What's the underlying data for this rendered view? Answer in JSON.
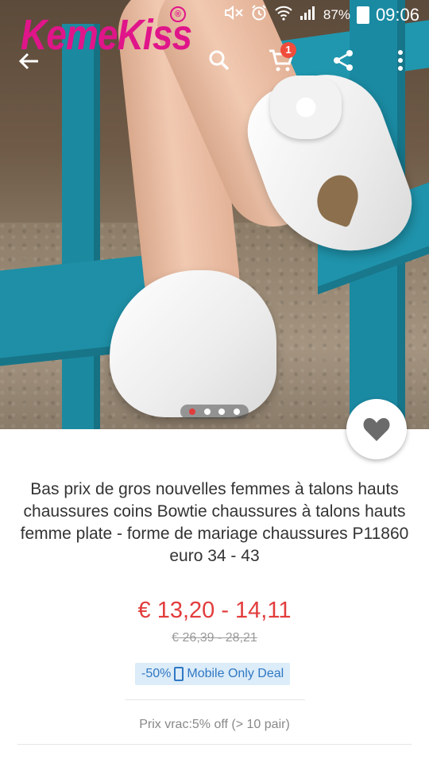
{
  "status_bar": {
    "battery_percent": "87%",
    "time": "09:06",
    "icons": [
      "mute-icon",
      "alarm-icon",
      "wifi-icon",
      "signal-icon",
      "battery-icon"
    ]
  },
  "app": {
    "logo_text": "KemeKiss",
    "logo_mark": "®",
    "brand_color": "#e0158a",
    "cart_count": "1",
    "icons": [
      "back-arrow-icon",
      "search-icon",
      "cart-icon",
      "share-icon",
      "more-vertical-icon",
      "heart-icon"
    ]
  },
  "gallery": {
    "image_count": 4,
    "active_index": 0,
    "image_description": "white wedge heel shoes with bow"
  },
  "product": {
    "title": "Bas prix de gros nouvelles femmes à talons hauts chaussures coins Bowtie chaussures à talons hauts femme plate - forme de mariage chaussures P11860 euro 34 - 43",
    "price": "€ 13,20 - 14,11",
    "old_price": "€ 26,39 - 28,21",
    "discount": "-50%",
    "deal_label": "Mobile Only Deal",
    "bulk_price": "Prix vrac:5% off (> 10 pair)",
    "price_color": "#e23c3c",
    "deal_color": "#2f78c4"
  }
}
